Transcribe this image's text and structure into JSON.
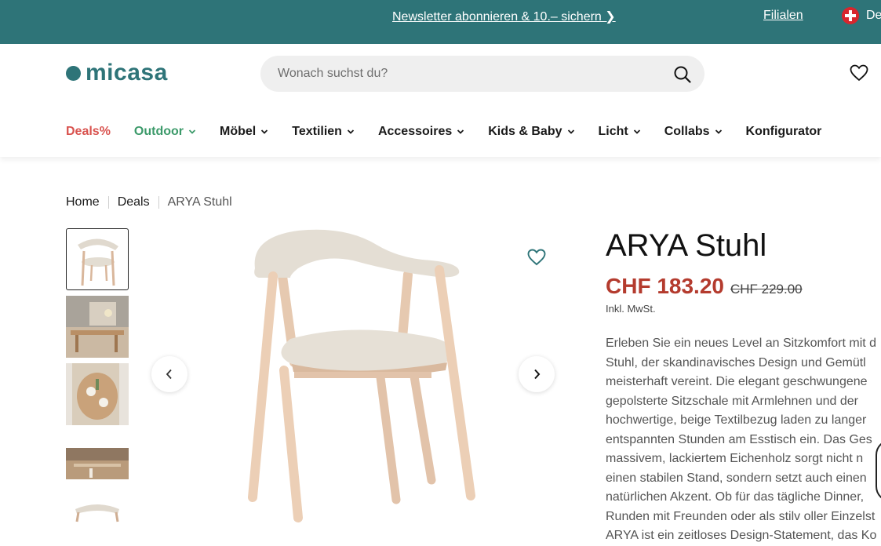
{
  "topbar": {
    "promo_link": "Newsletter abonnieren & 10.– sichern ❯",
    "stores_link": "Filialen",
    "language": "De"
  },
  "header": {
    "logo_text": "micasa",
    "search_placeholder": "Wonach suchst du?",
    "nav": [
      {
        "label": "Deals%"
      },
      {
        "label": "Outdoor"
      },
      {
        "label": "Möbel"
      },
      {
        "label": "Textilien"
      },
      {
        "label": "Accessoires"
      },
      {
        "label": "Kids & Baby"
      },
      {
        "label": "Licht"
      },
      {
        "label": "Collabs"
      },
      {
        "label": "Konfigurator"
      }
    ]
  },
  "breadcrumb": [
    "Home",
    "Deals",
    "ARYA Stuhl"
  ],
  "product": {
    "title": "ARYA Stuhl",
    "price_now": "CHF 183.20",
    "price_old": "CHF 229.00",
    "tax_note": "Inkl. MwSt.",
    "description_lines": [
      "Erleben Sie ein neues Level an Sitzkomfort mit d",
      "Stuhl, der skandinavisches Design und Gemütl",
      "meisterhaft vereint. Die elegant geschwungene",
      "gepolsterte Sitzschale mit Armlehnen und der",
      "hochwertige, beige Textilbezug laden zu langer",
      "entspannten Stunden am Esstisch ein. Das Ges",
      "massivem, lackiertem Eichenholz sorgt nicht n",
      "einen stabilen Stand, sondern setzt auch einen",
      "natürlichen Akzent. Ob für das tägliche Dinner,",
      "Runden mit Freunden oder als stilv oller Einzelst",
      "ARYA ist ein zeitloses Design-Statement, das Ko"
    ]
  },
  "colors": {
    "brand": "#2e7478",
    "deals": "#d9534f",
    "outdoor": "#3c9a6a",
    "price": "#b43b2e"
  },
  "icons": {
    "search": "search-icon",
    "wishlist": "heart-icon",
    "chevron": "chevron-down-icon",
    "prev": "chevron-left-icon",
    "next": "chevron-right-icon",
    "flag": "swiss-flag-icon"
  }
}
